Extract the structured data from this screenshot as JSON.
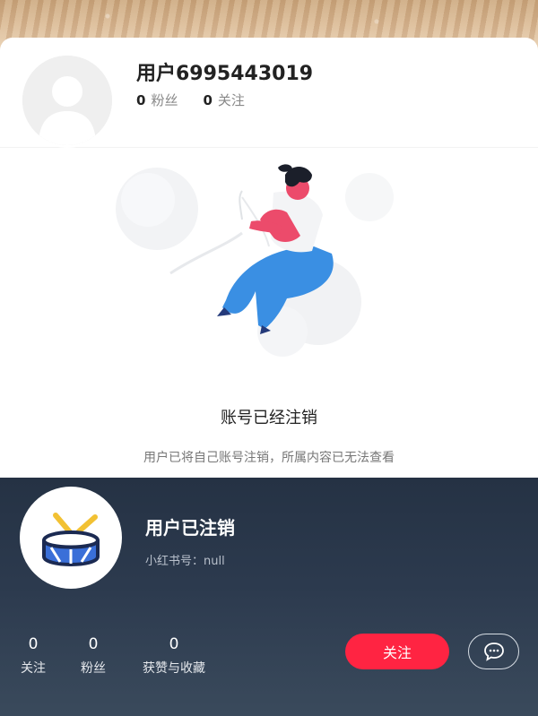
{
  "top_profile": {
    "username": "用户6995443019",
    "fans_count": "0",
    "fans_label": "粉丝",
    "following_count": "0",
    "following_label": "关注"
  },
  "deleted_notice": {
    "title": "账号已经注销",
    "description": "用户已将自己账号注销，所属内容已无法查看"
  },
  "bottom_profile": {
    "username": "用户已注销",
    "redbook_id": "小红书号：null",
    "stats": [
      {
        "value": "0",
        "label": "关注"
      },
      {
        "value": "0",
        "label": "粉丝"
      },
      {
        "value": "0",
        "label": "获赞与收藏"
      }
    ],
    "follow_label": "关注"
  },
  "colors": {
    "accent_red": "#ff2442",
    "dark_panel": "#2c3a4e"
  },
  "icons": [
    "default-avatar-icon",
    "drum-avatar-icon",
    "chat-bubble-icon"
  ]
}
